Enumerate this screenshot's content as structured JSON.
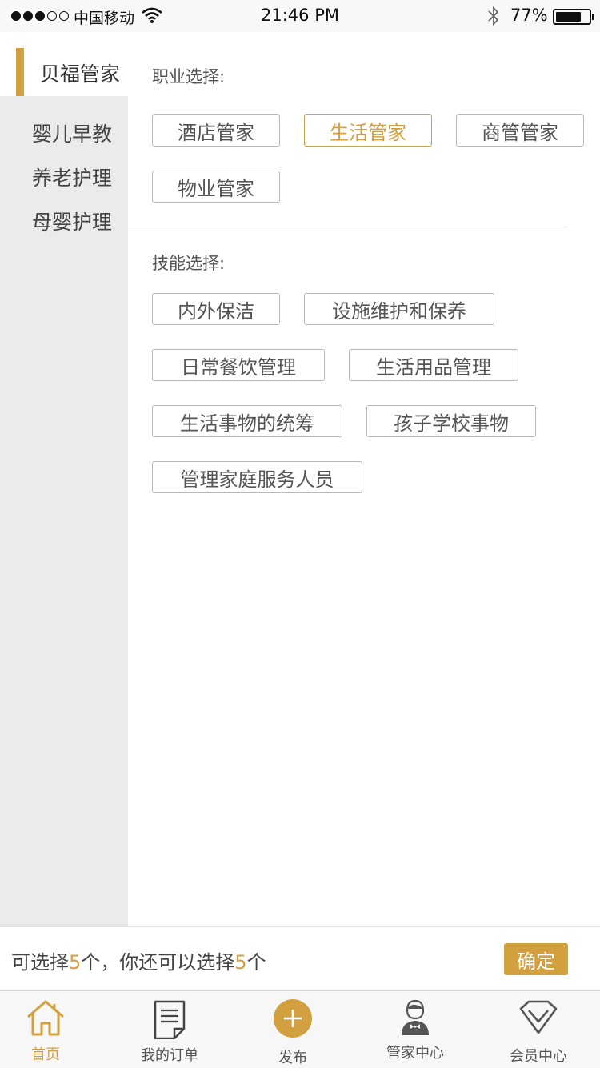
{
  "status_bar": {
    "carrier": "中国移动",
    "time": "21:46 PM",
    "battery": "77%",
    "battery_level": 0.77
  },
  "sidebar": {
    "active": "贝福管家",
    "items": [
      "婴儿早教",
      "养老护理",
      "母婴护理"
    ]
  },
  "career": {
    "title": "职业选择:",
    "options": [
      "酒店管家",
      "生活管家",
      "商管管家",
      "物业管家"
    ],
    "selected": "生活管家"
  },
  "skills": {
    "title": "技能选择:",
    "options": [
      "内外保洁",
      "设施维护和保养",
      "日常餐饮管理",
      "生活用品管理",
      "生活事物的统筹",
      "孩子学校事物",
      "管理家庭服务人员"
    ]
  },
  "selection_bar": {
    "prefix": "可选择",
    "max": "5",
    "middle": "个，你还可以选择",
    "remaining": "5",
    "suffix": "个",
    "confirm": "确定"
  },
  "tab_bar": {
    "tabs": [
      {
        "label": "首页",
        "icon": "home-icon",
        "active": true
      },
      {
        "label": "我的订单",
        "icon": "document-icon",
        "active": false
      },
      {
        "label": "发布",
        "icon": "plus-circle-icon",
        "active": false
      },
      {
        "label": "管家中心",
        "icon": "butler-icon",
        "active": false
      },
      {
        "label": "会员中心",
        "icon": "diamond-icon",
        "active": false
      }
    ]
  },
  "colors": {
    "accent": "#d3a03f",
    "sidebar_bg": "#ebebeb",
    "chip_border": "#b9b9b9"
  }
}
